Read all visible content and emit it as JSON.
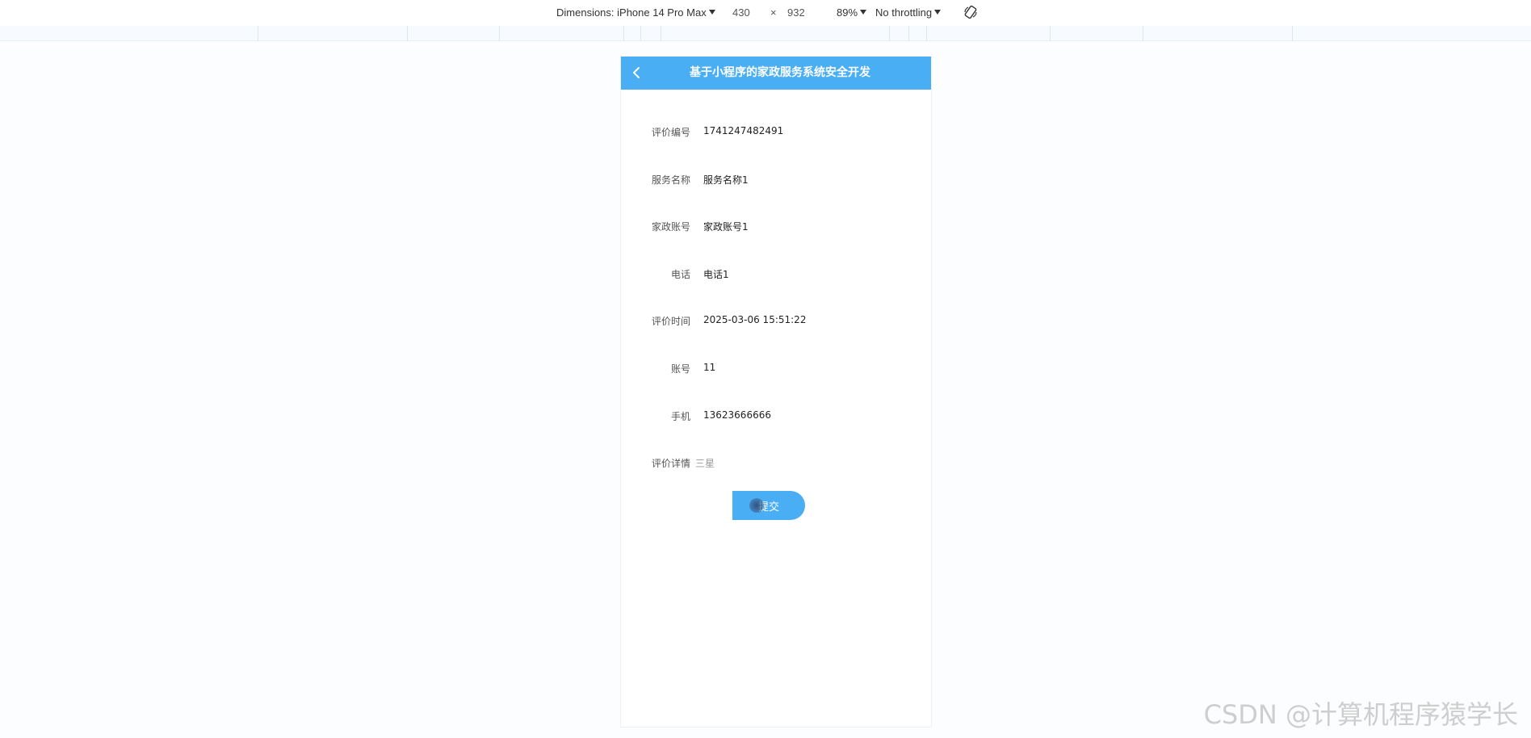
{
  "devtools": {
    "dimensions_label": "Dimensions: iPhone 14 Pro Max",
    "width_value": "430",
    "times_symbol": "×",
    "height_value": "932",
    "zoom": "89%",
    "throttling": "No throttling",
    "rotate_icon": "rotate-icon"
  },
  "app": {
    "title": "基于小程序的家政服务系统安全开发",
    "back_icon": "chevron-left-icon",
    "accent_color": "#4aaef5"
  },
  "details": {
    "rows": [
      {
        "label": "评价编号",
        "value": "1741247482491"
      },
      {
        "label": "服务名称",
        "value": "服务名称1"
      },
      {
        "label": "家政账号",
        "value": "家政账号1"
      },
      {
        "label": "电话",
        "value": "电话1"
      },
      {
        "label": "评价时间",
        "value": "2025-03-06 15:51:22"
      },
      {
        "label": "账号",
        "value": "11"
      },
      {
        "label": "手机",
        "value": "13623666666"
      },
      {
        "label": "评价详情",
        "value": "三星"
      }
    ],
    "submit_label": "提交"
  },
  "watermark": "CSDN @计算机程序猿学长"
}
